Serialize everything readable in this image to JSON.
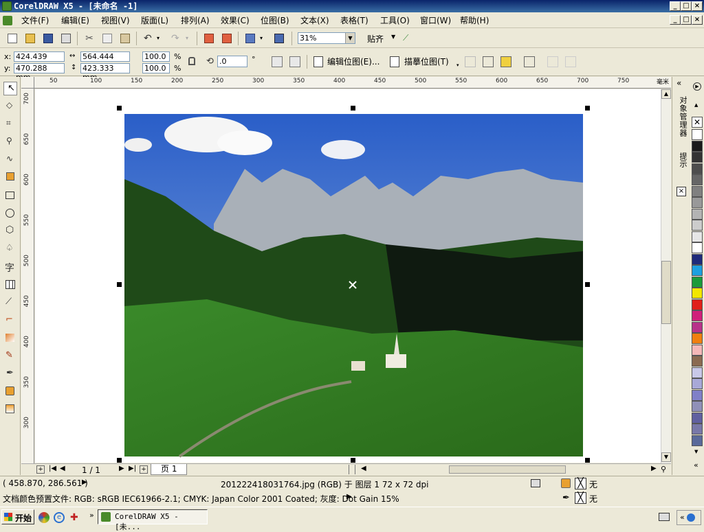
{
  "window": {
    "title": "CorelDRAW X5 - [未命名 -1]"
  },
  "menu": [
    "文件(F)",
    "编辑(E)",
    "视图(V)",
    "版面(L)",
    "排列(A)",
    "效果(C)",
    "位图(B)",
    "文本(X)",
    "表格(T)",
    "工具(O)",
    "窗口(W)",
    "帮助(H)"
  ],
  "standard_toolbar": {
    "zoom_value": "31%",
    "snap_label": "贴齐"
  },
  "property_bar": {
    "x_label": "x:",
    "x_value": "424.439 mm",
    "y_label": "y:",
    "y_value": "470.288 mm",
    "width_value": "564.444 mm",
    "height_value": "423.333 mm",
    "scale_x": "100.0",
    "scale_y": "100.0",
    "percent": "%",
    "rotation_value": ".0",
    "degree": "°",
    "edit_bitmap_label": "编辑位图(E)...",
    "trace_bitmap_label": "描摹位图(T)"
  },
  "ruler": {
    "h_ticks": [
      "50",
      "100",
      "150",
      "200",
      "250",
      "300",
      "350",
      "400",
      "450",
      "500",
      "550",
      "600",
      "650",
      "700",
      "750"
    ],
    "h_unit": "毫米",
    "v_ticks": [
      "700",
      "650",
      "600",
      "550",
      "500",
      "450",
      "400",
      "350",
      "300"
    ]
  },
  "docker": {
    "tab1": "对象管理器",
    "tab2": "提示"
  },
  "palette_colors": [
    "#ffffff",
    "#1a1a1a",
    "#333333",
    "#4d4d4d",
    "#666666",
    "#808080",
    "#999999",
    "#b3b3b3",
    "#cccccc",
    "#e6e6e6",
    "#ffffff",
    "#1f2a7a",
    "#1ea0e0",
    "#1a9a3a",
    "#f2e600",
    "#e0201a",
    "#d0207a",
    "#b8328a",
    "#f08010",
    "#f4b8b8",
    "#8a6a50",
    "#c8c8e8",
    "#a8a8d8",
    "#8080c8",
    "#9090b8",
    "#6060a0",
    "#7878a8",
    "#5a6a9a"
  ],
  "page_nav": {
    "page_count": "1 / 1",
    "page_tab": "页 1"
  },
  "status": {
    "coords": "( 458.870, 286.561 )",
    "object_info": "201222418031764.jpg (RGB) 于 图层 1 72 x 72 dpi",
    "color_profile": "文档颜色预置文件: RGB: sRGB IEC61966-2.1; CMYK: Japan Color 2001 Coated; 灰度: Dot Gain 15%",
    "fill_none": "无",
    "outline_none": "无"
  },
  "taskbar": {
    "start_label": "开始",
    "task_label": "CorelDRAW X5 - [未..."
  }
}
